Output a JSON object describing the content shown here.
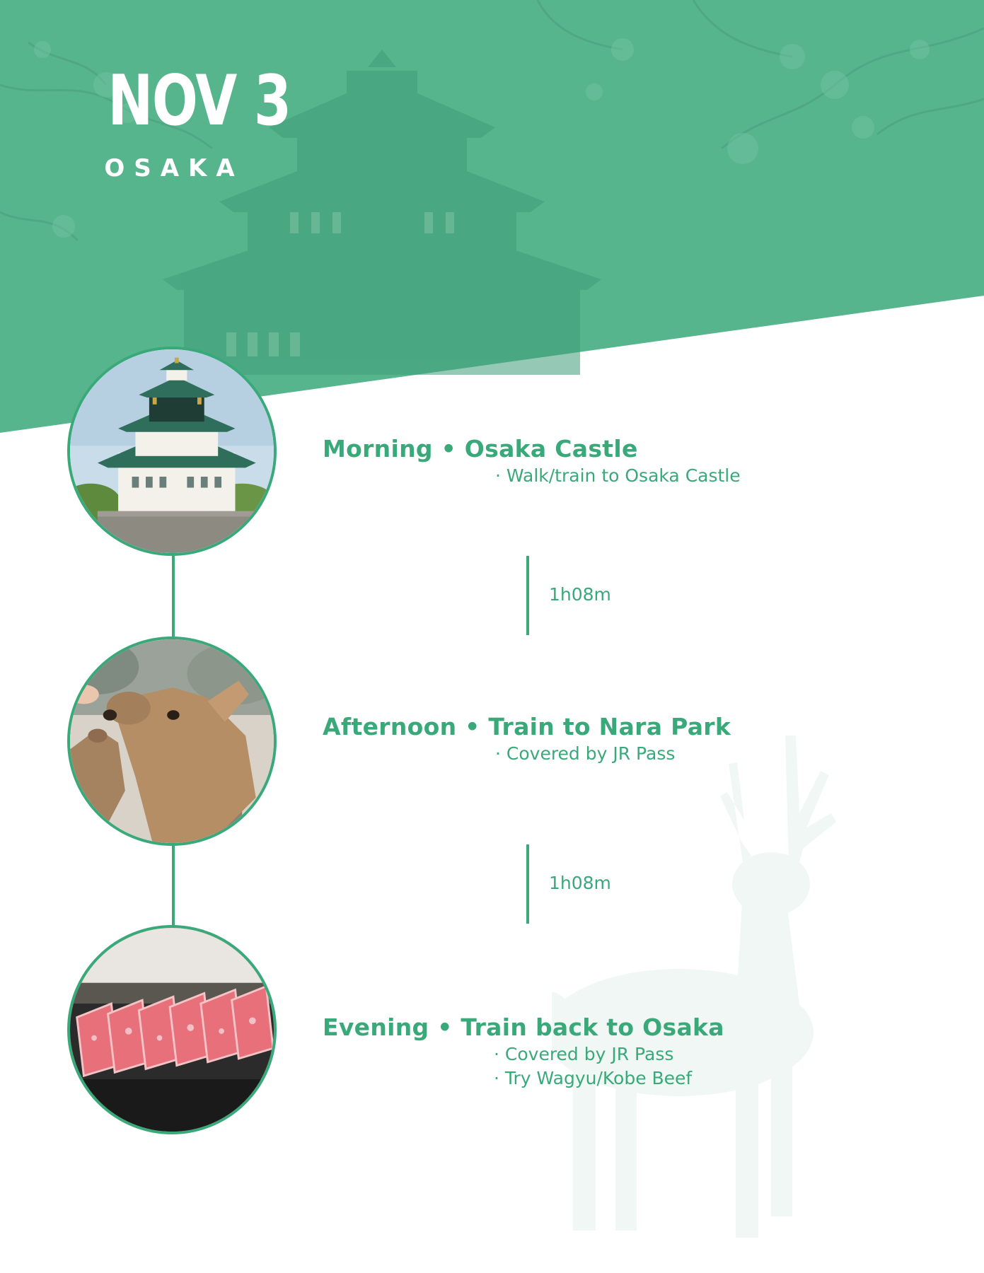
{
  "header": {
    "date": "NOV 3",
    "city": "OSAKA"
  },
  "colors": {
    "accent": "#3aa97a",
    "header_green": "#57b58e",
    "watermark": "#f1f7f4"
  },
  "events": [
    {
      "title": "Morning • Osaka Castle",
      "notes": [
        "· Walk/train to Osaka Castle"
      ],
      "photo": "osaka-castle-photo"
    },
    {
      "title": "Afternoon • Train to Nara Park",
      "notes": [
        "· Covered by JR Pass"
      ],
      "photo": "nara-deer-photo"
    },
    {
      "title": "Evening  • Train back to Osaka",
      "notes": [
        "· Covered by JR Pass",
        "· Try Wagyu/Kobe Beef"
      ],
      "photo": "wagyu-beef-photo"
    }
  ],
  "durations": [
    "1h08m",
    "1h08m"
  ],
  "icons": [
    "deer-silhouette-icon"
  ]
}
